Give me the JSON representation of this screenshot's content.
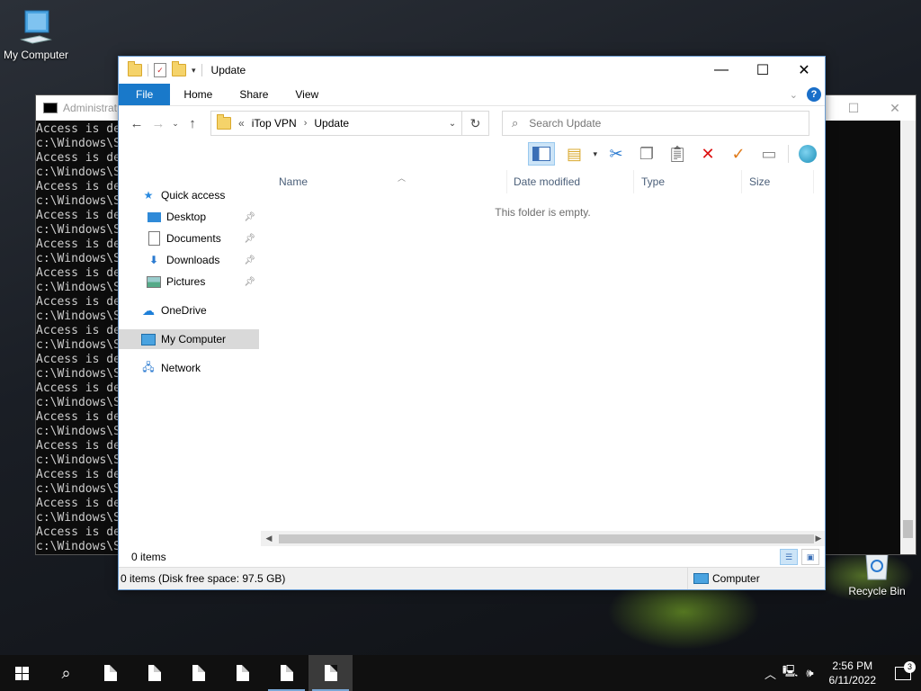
{
  "desktop": {
    "icons": [
      {
        "label": "My Computer",
        "icon": "computer-icon"
      },
      {
        "label": "Recycle Bin",
        "icon": "recycle-bin-icon"
      }
    ]
  },
  "cmd": {
    "title": "Administrat",
    "lines": [
      "Access is de",
      "c:\\Windows\\S"
    ]
  },
  "explorer": {
    "title": "Update",
    "ribbon_tabs": [
      "File",
      "Home",
      "Share",
      "View"
    ],
    "address": {
      "prefix": "«",
      "crumbs": [
        "iTop VPN",
        "Update"
      ]
    },
    "search_placeholder": "Search Update",
    "nav": {
      "quick_access": "Quick access",
      "pinned": [
        "Desktop",
        "Documents",
        "Downloads",
        "Pictures"
      ],
      "onedrive": "OneDrive",
      "my_computer": "My Computer",
      "network": "Network"
    },
    "columns": [
      "Name",
      "Date modified",
      "Type",
      "Size"
    ],
    "empty_message": "This folder is empty.",
    "status_items": "0 items",
    "details": "0 items (Disk free space: 97.5 GB)",
    "details_location": "Computer"
  },
  "taskbar": {
    "time": "2:56 PM",
    "date": "6/11/2022",
    "notification_count": "3"
  }
}
